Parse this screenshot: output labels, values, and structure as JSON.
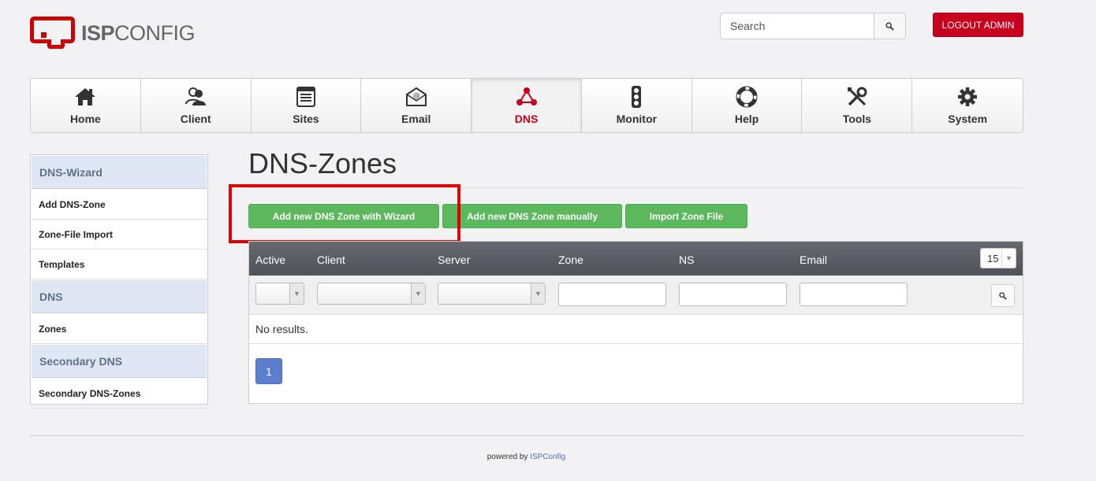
{
  "header": {
    "logo_bold": "ISP",
    "logo_light": "CONFIG",
    "search_placeholder": "Search",
    "logout_label": "LOGOUT ADMIN"
  },
  "nav": {
    "items": [
      {
        "label": "Home",
        "icon": "home-icon"
      },
      {
        "label": "Client",
        "icon": "client-icon"
      },
      {
        "label": "Sites",
        "icon": "sites-icon"
      },
      {
        "label": "Email",
        "icon": "email-icon"
      },
      {
        "label": "DNS",
        "icon": "dns-icon",
        "active": true
      },
      {
        "label": "Monitor",
        "icon": "monitor-icon"
      },
      {
        "label": "Help",
        "icon": "help-icon"
      },
      {
        "label": "Tools",
        "icon": "tools-icon"
      },
      {
        "label": "System",
        "icon": "system-icon"
      }
    ]
  },
  "sidebar": {
    "sections": [
      {
        "title": "DNS-Wizard",
        "items": [
          "Add DNS-Zone",
          "Zone-File Import",
          "Templates"
        ]
      },
      {
        "title": "DNS",
        "items": [
          "Zones"
        ]
      },
      {
        "title": "Secondary DNS",
        "items": [
          "Secondary DNS-Zones"
        ]
      }
    ]
  },
  "main": {
    "title": "DNS-Zones",
    "buttons": {
      "wizard": "Add new DNS Zone with Wizard",
      "manual": "Add new DNS Zone manually",
      "import": "Import Zone File"
    },
    "table": {
      "columns": [
        "Active",
        "Client",
        "Server",
        "Zone",
        "NS",
        "Email"
      ],
      "per_page": "15",
      "no_results": "No results.",
      "current_page": "1"
    }
  },
  "footer": {
    "prefix": "powered by",
    "link": "ISPConfig"
  },
  "colors": {
    "accent_red": "#c8001e",
    "green": "#5cb85c",
    "pager_blue": "#5b7ecf",
    "highlight": "#e00000"
  }
}
